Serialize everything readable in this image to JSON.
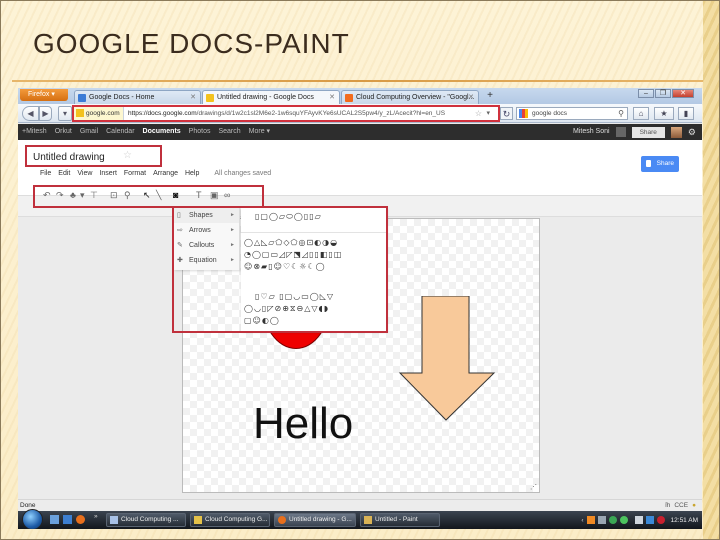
{
  "slide": {
    "title": "GOOGLE DOCS-PAINT"
  },
  "browser": {
    "app_button": "Firefox",
    "tabs": [
      {
        "label": "Google Docs - Home",
        "active": false,
        "favicon_color": "#3b7bd6"
      },
      {
        "label": "Untitled drawing - Google Docs",
        "active": true,
        "favicon_color": "#f3c21f"
      },
      {
        "label": "Cloud Computing Overview - \"Googl...",
        "active": false,
        "favicon_color": "#f26b1d"
      }
    ],
    "new_tab": "+",
    "url_identity": "google.com",
    "url_host": "https://docs.google.com",
    "url_path": "/drawings/d/1w2c1sl2M6e2-1w6squYFAyvKYe6sUCAL2S5pw4/y_zL/Acecit?hl=en_US",
    "search_value": "google docs",
    "window_controls": {
      "minimize": "–",
      "restore": "❐",
      "close": "✕"
    }
  },
  "google_bar": {
    "links": [
      "+Mitesh",
      "Orkut",
      "Gmail",
      "Calendar",
      "Documents",
      "Photos",
      "Search",
      "More ▾"
    ],
    "current": "Documents",
    "user": "Mitesh Soni",
    "share_label": "Share"
  },
  "doc": {
    "title": "Untitled drawing",
    "menu": [
      "File",
      "Edit",
      "View",
      "Insert",
      "Format",
      "Arrange",
      "Help"
    ],
    "save_status": "All changes saved",
    "share_button": "Share"
  },
  "toolbar": {
    "tools": [
      {
        "name": "undo-icon",
        "glyph": "↶"
      },
      {
        "name": "redo-icon",
        "glyph": "↷"
      },
      {
        "name": "paint-format-icon",
        "glyph": "♣"
      },
      {
        "name": "dropdown-icon",
        "glyph": "▾"
      },
      {
        "name": "align-icon",
        "glyph": "⊤"
      },
      {
        "name": "fit-icon",
        "glyph": "⊡"
      },
      {
        "name": "zoom-icon",
        "glyph": "⚲"
      },
      {
        "name": "select-icon",
        "glyph": "↖"
      },
      {
        "name": "line-icon",
        "glyph": "╲"
      },
      {
        "name": "shape-icon",
        "glyph": "◙"
      },
      {
        "name": "textbox-icon",
        "glyph": "T"
      },
      {
        "name": "image-icon",
        "glyph": "▣"
      },
      {
        "name": "link-icon",
        "glyph": "∞"
      }
    ]
  },
  "insert_menu": {
    "items": [
      {
        "label": "Shapes",
        "icon": "▯"
      },
      {
        "label": "Arrows",
        "icon": "⇨"
      },
      {
        "label": "Callouts",
        "icon": "✎"
      },
      {
        "label": "Equation",
        "icon": "✚"
      }
    ],
    "shape_rows": [
      "▯▢◯▱⬭◯▯▯▱",
      "◯△◺▱⬠◇⬠◎⊡◐◑◒",
      "◔◯▢▭◿◸⬔◿▯▯◧▯◫",
      "☺⊗▰▯☺♡☾☼☾◯",
      "▯♡▱  ▯▢◡▭◯◺▽",
      "◯◡▯◸⊘⊕⧖⊖△▽◖◗",
      "▢☺◐◯"
    ]
  },
  "canvas": {
    "text": "Hello",
    "circle_color": "#ee0000",
    "arrow_color": "#f8c99a",
    "resize_grip": "⋰"
  },
  "status": {
    "left": "Done",
    "right": [
      "ỉh",
      "CCE"
    ]
  },
  "taskbar": {
    "items": [
      {
        "label": "Cloud Computing ...",
        "icon_color": "#a8c1e6",
        "active": false
      },
      {
        "label": "Cloud Computing G...",
        "icon_color": "#e5c24a",
        "active": false
      },
      {
        "label": "Untitled drawing - G...",
        "icon_color": "#e86f1c",
        "active": true
      },
      {
        "label": "Untitled - Paint",
        "icon_color": "#d9b356",
        "active": false
      }
    ],
    "overflow": "»",
    "tray_chevron": "‹",
    "clock": "12:51 AM"
  }
}
